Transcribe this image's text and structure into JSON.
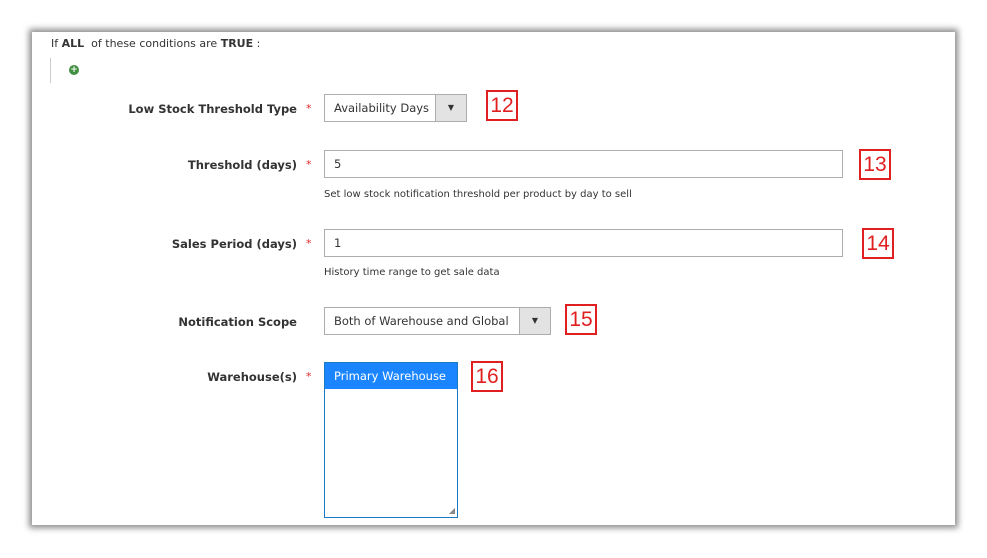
{
  "conditions": {
    "prefix": "If",
    "all": "ALL",
    "middle": "of these conditions are",
    "true": "TRUE",
    "suffix": ":"
  },
  "fields": {
    "threshold_type": {
      "label": "Low Stock Threshold Type",
      "value": "Availability Days",
      "badge": "12"
    },
    "threshold_days": {
      "label": "Threshold (days)",
      "value": "5",
      "note": "Set low stock notification threshold per product by day to sell",
      "badge": "13"
    },
    "sales_period": {
      "label": "Sales Period (days)",
      "value": "1",
      "note": "History time range to get sale data",
      "badge": "14"
    },
    "notification_scope": {
      "label": "Notification Scope",
      "value": "Both of Warehouse and Global",
      "badge": "15"
    },
    "warehouses": {
      "label": "Warehouse(s)",
      "options": [
        "Primary Warehouse"
      ],
      "badge": "16"
    }
  },
  "required_mark": "*"
}
